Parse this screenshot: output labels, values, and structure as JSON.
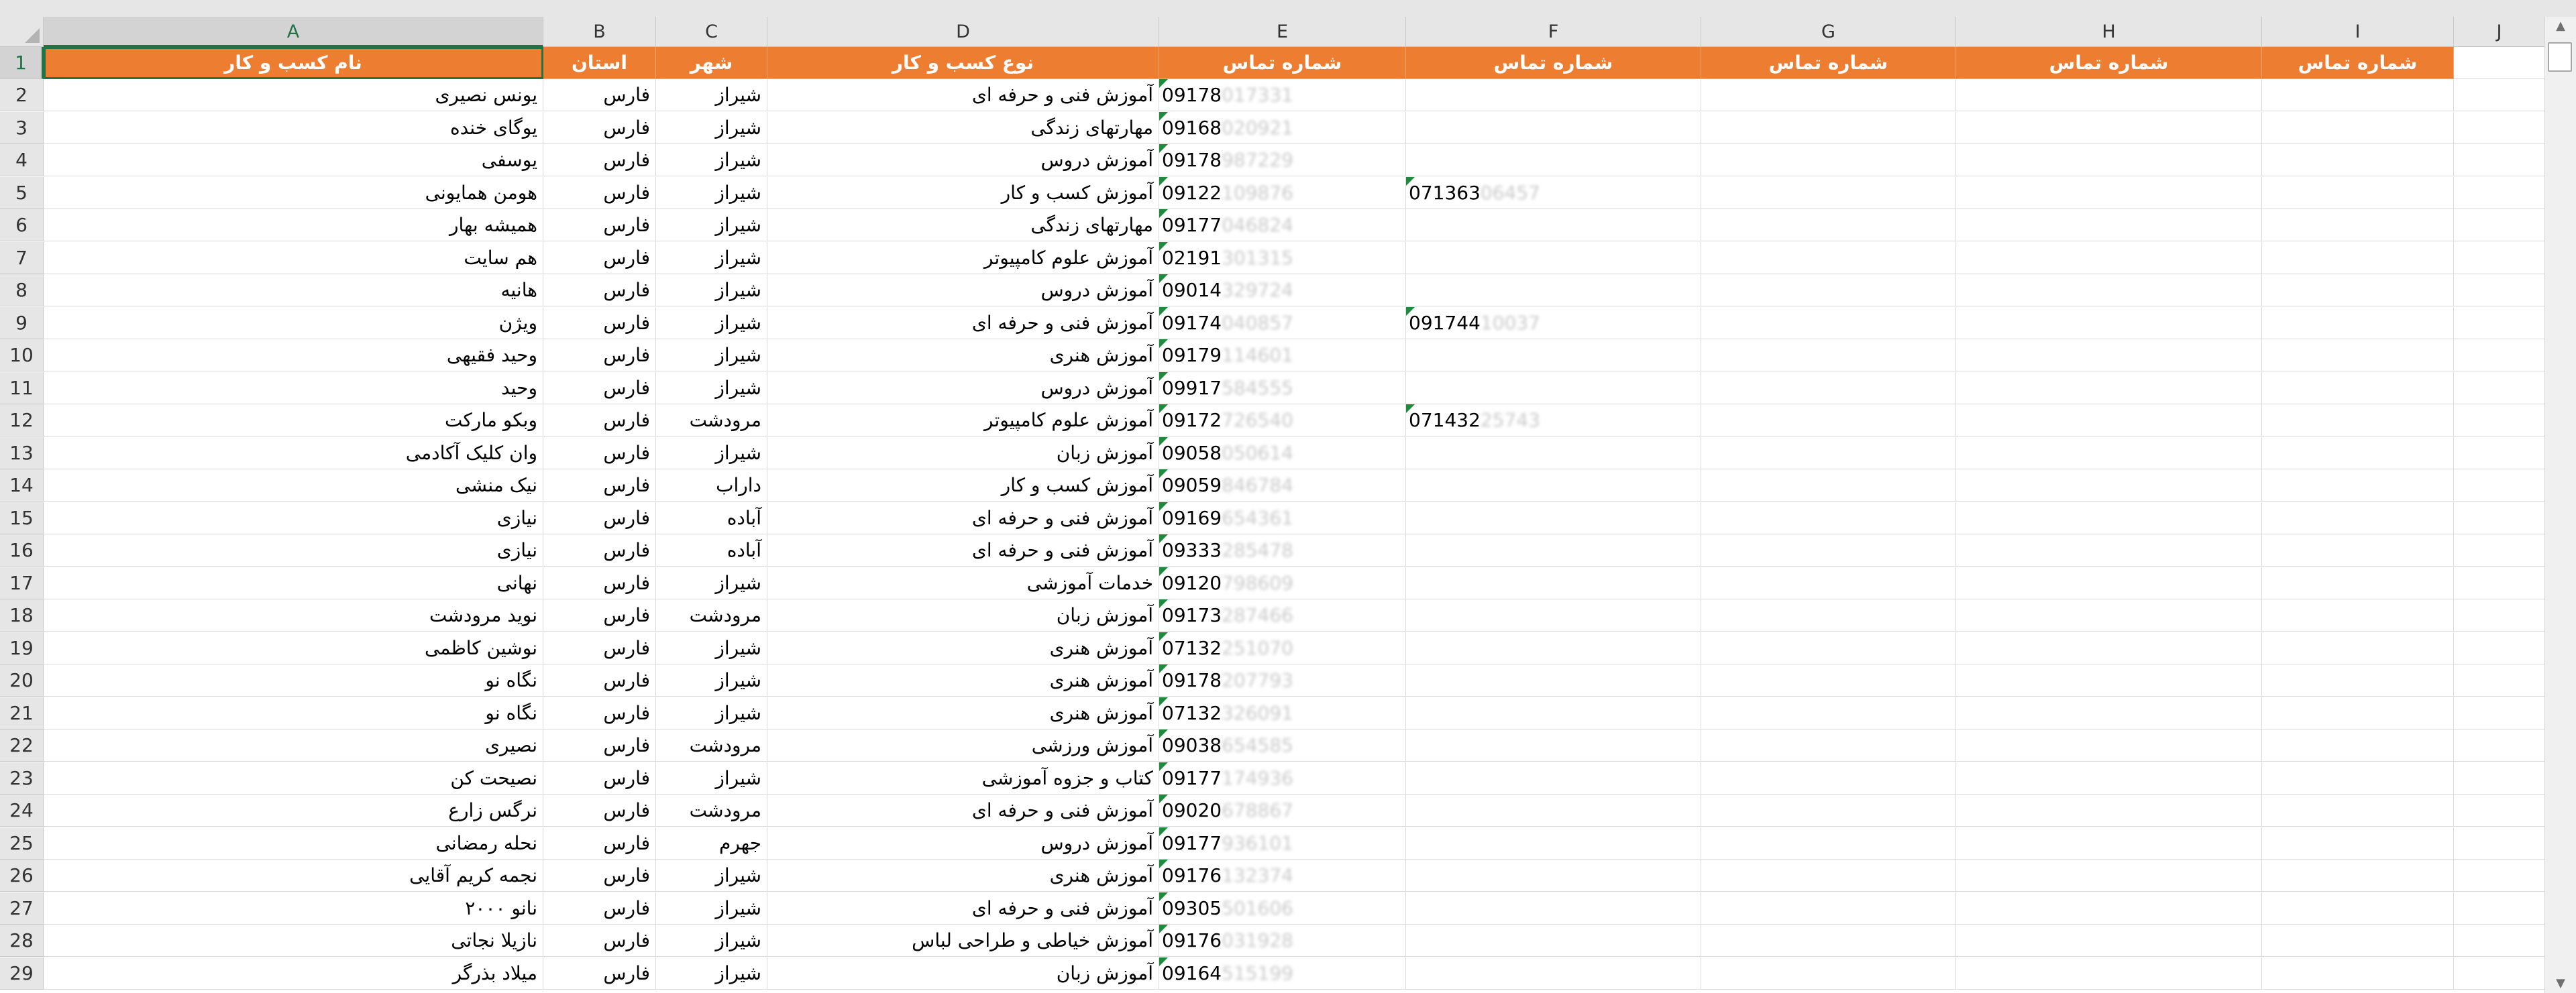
{
  "columns": [
    "A",
    "B",
    "C",
    "D",
    "E",
    "F",
    "G",
    "H",
    "I",
    "J"
  ],
  "selected_column": "A",
  "selected_row": "1",
  "accent_color": "#ed7d31",
  "header_row": {
    "num": "1",
    "name": "نام کسب و کار",
    "province": "استان",
    "city": "شهر",
    "type": "نوع کسب و کار",
    "phone_e": "شماره تماس",
    "phone_f": "شماره تماس",
    "phone_g": "شماره تماس",
    "phone_h": "شماره تماس",
    "phone_i": "شماره تماس"
  },
  "rows": [
    {
      "num": "2",
      "name": "یونس نصیری",
      "province": "فارس",
      "city": "شیراز",
      "type": "آموزش فنی و حرفه ای",
      "phone_e_visible": "09178",
      "phone_e_faded": "017331",
      "phone_f_visible": "",
      "phone_f_faded": ""
    },
    {
      "num": "3",
      "name": "یوگای خنده",
      "province": "فارس",
      "city": "شیراز",
      "type": "مهارتهای زندگی",
      "phone_e_visible": "09168",
      "phone_e_faded": "020921",
      "phone_f_visible": "",
      "phone_f_faded": ""
    },
    {
      "num": "4",
      "name": "یوسفی",
      "province": "فارس",
      "city": "شیراز",
      "type": "آموزش دروس",
      "phone_e_visible": "09178",
      "phone_e_faded": "987229",
      "phone_f_visible": "",
      "phone_f_faded": ""
    },
    {
      "num": "5",
      "name": "هومن همایونی",
      "province": "فارس",
      "city": "شیراز",
      "type": "آموزش کسب و کار",
      "phone_e_visible": "09122",
      "phone_e_faded": "109876",
      "phone_f_visible": "071363",
      "phone_f_faded": "06457"
    },
    {
      "num": "6",
      "name": "همیشه بهار",
      "province": "فارس",
      "city": "شیراز",
      "type": "مهارتهای زندگی",
      "phone_e_visible": "09177",
      "phone_e_faded": "046824",
      "phone_f_visible": "",
      "phone_f_faded": ""
    },
    {
      "num": "7",
      "name": "هم سایت",
      "province": "فارس",
      "city": "شیراز",
      "type": "آموزش علوم کامپیوتر",
      "phone_e_visible": "02191",
      "phone_e_faded": "301315",
      "phone_f_visible": "",
      "phone_f_faded": ""
    },
    {
      "num": "8",
      "name": "هانیه",
      "province": "فارس",
      "city": "شیراز",
      "type": "آموزش دروس",
      "phone_e_visible": "09014",
      "phone_e_faded": "329724",
      "phone_f_visible": "",
      "phone_f_faded": ""
    },
    {
      "num": "9",
      "name": "ویژن",
      "province": "فارس",
      "city": "شیراز",
      "type": "آموزش فنی و حرفه ای",
      "phone_e_visible": "09174",
      "phone_e_faded": "040857",
      "phone_f_visible": "091744",
      "phone_f_faded": "10037"
    },
    {
      "num": "10",
      "name": "وحید فقیهی",
      "province": "فارس",
      "city": "شیراز",
      "type": "آموزش هنری",
      "phone_e_visible": "09179",
      "phone_e_faded": "114601",
      "phone_f_visible": "",
      "phone_f_faded": ""
    },
    {
      "num": "11",
      "name": "وحید",
      "province": "فارس",
      "city": "شیراز",
      "type": "آموزش دروس",
      "phone_e_visible": "09917",
      "phone_e_faded": "584555",
      "phone_f_visible": "",
      "phone_f_faded": ""
    },
    {
      "num": "12",
      "name": "وبکو مارکت",
      "province": "فارس",
      "city": "مرودشت",
      "type": "آموزش علوم کامپیوتر",
      "phone_e_visible": "09172",
      "phone_e_faded": "726540",
      "phone_f_visible": "071432",
      "phone_f_faded": "25743"
    },
    {
      "num": "13",
      "name": "وان کلیک آکادمی",
      "province": "فارس",
      "city": "شیراز",
      "type": "آموزش زبان",
      "phone_e_visible": "09058",
      "phone_e_faded": "050614",
      "phone_f_visible": "",
      "phone_f_faded": ""
    },
    {
      "num": "14",
      "name": "نیک منشی",
      "province": "فارس",
      "city": "داراب",
      "type": "آموزش کسب و کار",
      "phone_e_visible": "09059",
      "phone_e_faded": "846784",
      "phone_f_visible": "",
      "phone_f_faded": ""
    },
    {
      "num": "15",
      "name": "نیازی",
      "province": "فارس",
      "city": "آباده",
      "type": "آموزش فنی و حرفه ای",
      "phone_e_visible": "09169",
      "phone_e_faded": "654361",
      "phone_f_visible": "",
      "phone_f_faded": ""
    },
    {
      "num": "16",
      "name": "نیازی",
      "province": "فارس",
      "city": "آباده",
      "type": "آموزش فنی و حرفه ای",
      "phone_e_visible": "09333",
      "phone_e_faded": "285478",
      "phone_f_visible": "",
      "phone_f_faded": ""
    },
    {
      "num": "17",
      "name": "نهانی",
      "province": "فارس",
      "city": "شیراز",
      "type": "خدمات آموزشی",
      "phone_e_visible": "09120",
      "phone_e_faded": "798609",
      "phone_f_visible": "",
      "phone_f_faded": ""
    },
    {
      "num": "18",
      "name": "نوید مرودشت",
      "province": "فارس",
      "city": "مرودشت",
      "type": "آموزش زبان",
      "phone_e_visible": "09173",
      "phone_e_faded": "287466",
      "phone_f_visible": "",
      "phone_f_faded": ""
    },
    {
      "num": "19",
      "name": "نوشین کاظمی",
      "province": "فارس",
      "city": "شیراز",
      "type": "آموزش هنری",
      "phone_e_visible": "07132",
      "phone_e_faded": "251070",
      "phone_f_visible": "",
      "phone_f_faded": ""
    },
    {
      "num": "20",
      "name": "نگاه نو",
      "province": "فارس",
      "city": "شیراز",
      "type": "آموزش هنری",
      "phone_e_visible": "09178",
      "phone_e_faded": "207793",
      "phone_f_visible": "",
      "phone_f_faded": ""
    },
    {
      "num": "21",
      "name": "نگاه نو",
      "province": "فارس",
      "city": "شیراز",
      "type": "آموزش هنری",
      "phone_e_visible": "07132",
      "phone_e_faded": "326091",
      "phone_f_visible": "",
      "phone_f_faded": ""
    },
    {
      "num": "22",
      "name": "نصیری",
      "province": "فارس",
      "city": "مرودشت",
      "type": "آموزش ورزشی",
      "phone_e_visible": "09038",
      "phone_e_faded": "654585",
      "phone_f_visible": "",
      "phone_f_faded": ""
    },
    {
      "num": "23",
      "name": "نصیحت کن",
      "province": "فارس",
      "city": "شیراز",
      "type": "کتاب و جزوه آموزشی",
      "phone_e_visible": "09177",
      "phone_e_faded": "174936",
      "phone_f_visible": "",
      "phone_f_faded": ""
    },
    {
      "num": "24",
      "name": "نرگس زارع",
      "province": "فارس",
      "city": "مرودشت",
      "type": "آموزش فنی و حرفه ای",
      "phone_e_visible": "09020",
      "phone_e_faded": "678867",
      "phone_f_visible": "",
      "phone_f_faded": ""
    },
    {
      "num": "25",
      "name": "نحله رمضانی",
      "province": "فارس",
      "city": "جهرم",
      "type": "آموزش دروس",
      "phone_e_visible": "09177",
      "phone_e_faded": "936101",
      "phone_f_visible": "",
      "phone_f_faded": ""
    },
    {
      "num": "26",
      "name": "نجمه کریم آقایی",
      "province": "فارس",
      "city": "شیراز",
      "type": "آموزش هنری",
      "phone_e_visible": "09176",
      "phone_e_faded": "132374",
      "phone_f_visible": "",
      "phone_f_faded": ""
    },
    {
      "num": "27",
      "name": "نانو ۲۰۰۰",
      "province": "فارس",
      "city": "شیراز",
      "type": "آموزش فنی و حرفه ای",
      "phone_e_visible": "09305",
      "phone_e_faded": "501606",
      "phone_f_visible": "",
      "phone_f_faded": ""
    },
    {
      "num": "28",
      "name": "نازیلا نجاتی",
      "province": "فارس",
      "city": "شیراز",
      "type": "آموزش خیاطی و طراحی لباس",
      "phone_e_visible": "09176",
      "phone_e_faded": "031928",
      "phone_f_visible": "",
      "phone_f_faded": ""
    },
    {
      "num": "29",
      "name": "میلاد بذرگر",
      "province": "فارس",
      "city": "شیراز",
      "type": "آموزش زبان",
      "phone_e_visible": "09164",
      "phone_e_faded": "515199",
      "phone_f_visible": "",
      "phone_f_faded": ""
    }
  ]
}
